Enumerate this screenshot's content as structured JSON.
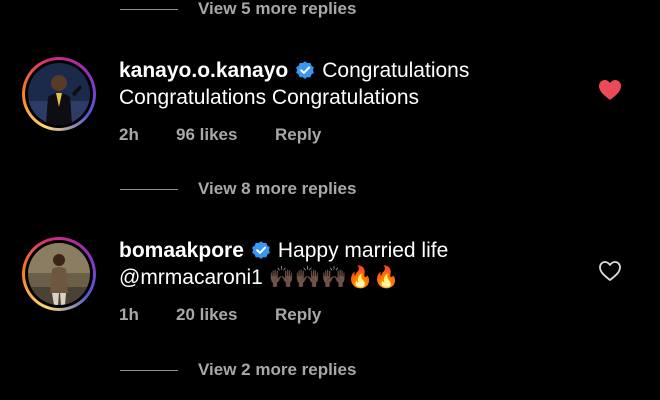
{
  "view_more_top": "View 5 more replies",
  "comments": [
    {
      "username": "kanayo.o.kanayo",
      "text_line1": "Congratulations",
      "text_line2": "Congratulations Congratulations",
      "time": "2h",
      "likes": "96 likes",
      "reply": "Reply",
      "liked": true
    },
    {
      "username": "bomaakpore",
      "text_line1": "Happy married life",
      "text_line2": "@mrmacaroni1 🙌🏿🙌🏿🙌🏿🔥🔥",
      "time": "1h",
      "likes": "20 likes",
      "reply": "Reply",
      "liked": false
    }
  ],
  "view_more_mid": "View 8 more replies",
  "view_more_bottom": "View 2 more replies",
  "colors": {
    "verified": "#3897f0",
    "heart_liked": "#ed4956",
    "muted": "#a8a8a8"
  }
}
